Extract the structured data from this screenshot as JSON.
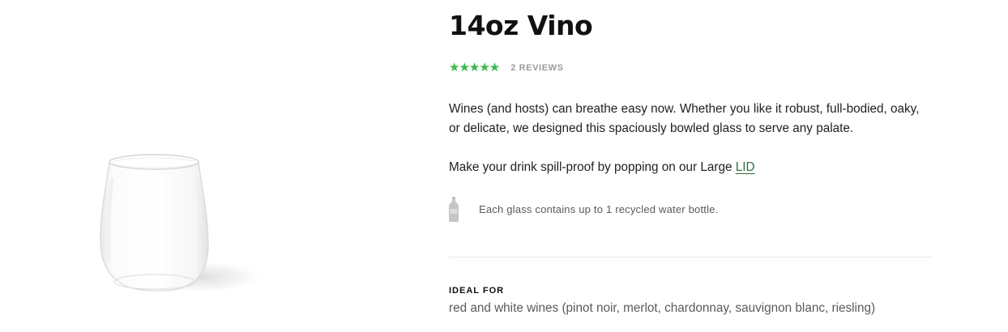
{
  "product": {
    "title": "14oz Vino",
    "rating": {
      "value": 5,
      "max": 5,
      "stars_glyphs": "★★★★★",
      "reviews_label": "2 REVIEWS",
      "star_color": "#3cb94b"
    },
    "description": "Wines (and hosts) can breathe easy now. Whether you like it robust, full-bodied, oaky, or delicate, we designed this spaciously bowled glass to serve any palate.",
    "lid_prefix": "Make your drink spill-proof by popping on our Large ",
    "lid_link_label": "LID",
    "recycle_icon": "water-bottle-icon",
    "recycle_note": "Each glass contains up to 1 recycled water bottle.",
    "ideal_for": {
      "heading": "IDEAL FOR",
      "text": "red and white wines (pinot noir, merlot, chardonnay, sauvignon blanc, riesling)"
    }
  },
  "colors": {
    "accent_green": "#3cb94b",
    "link_green": "#2f6f3a",
    "muted_text": "#5a5a5a"
  }
}
